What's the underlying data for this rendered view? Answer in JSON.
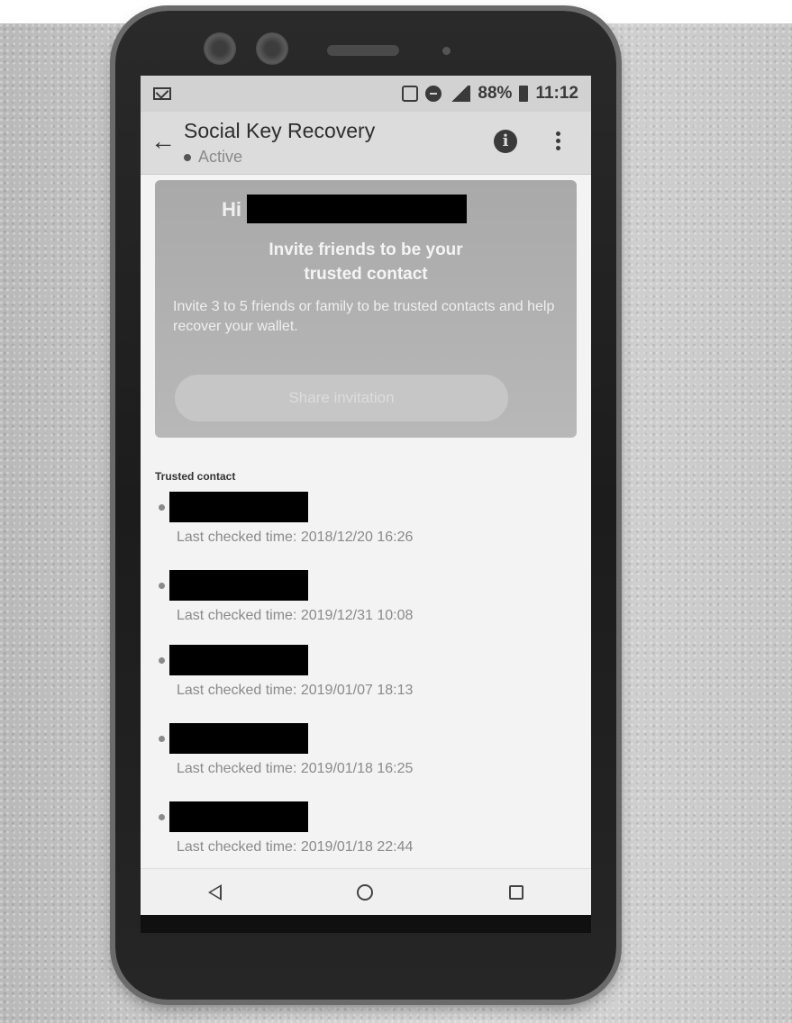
{
  "status_bar": {
    "battery": "88%",
    "time": "11:12"
  },
  "app_bar": {
    "back_glyph": "←",
    "title": "Social Key Recovery",
    "status": "Active",
    "info_glyph": "i"
  },
  "invite_card": {
    "greeting": "Hi",
    "title_line1": "Invite friends to be your",
    "title_line2": "trusted contact",
    "description": "Invite 3 to 5 friends or family to be trusted contacts and help recover your wallet.",
    "share_button": "Share invitation"
  },
  "trusted_contacts": {
    "label": "Trusted contact",
    "items": [
      {
        "time": "Last checked time: 2018/12/20 16:26"
      },
      {
        "time": "Last checked time: 2019/12/31 10:08"
      },
      {
        "time": "Last checked time: 2019/01/07 18:13"
      },
      {
        "time": "Last checked time: 2019/01/18 16:25"
      },
      {
        "time": "Last checked time: 2019/01/18 22:44"
      }
    ]
  },
  "icons": {
    "status_left": "mail-icon",
    "status_right": [
      "nfc-icon",
      "do-not-disturb-icon",
      "signal-icon",
      "battery-icon"
    ],
    "nav": [
      "nav-back-icon",
      "nav-home-icon",
      "nav-recent-apps-icon"
    ]
  }
}
